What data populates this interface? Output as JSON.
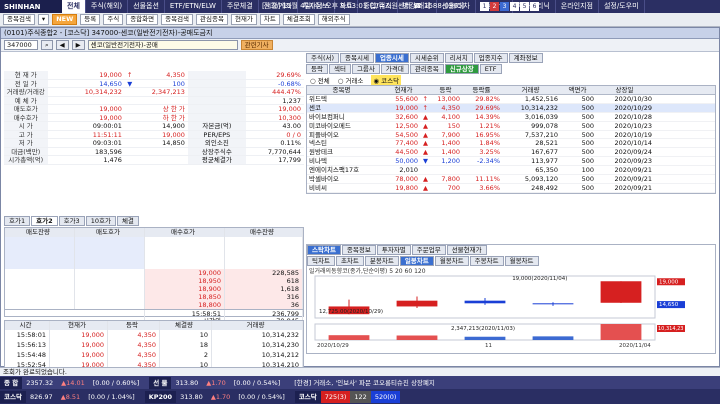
{
  "topbar": {
    "brand": "SHINHAN",
    "menu": [
      "전체",
      "주식(해외)",
      "선물옵션",
      "ETF/ETN/ELW",
      "주문체결",
      "잔고/계좌",
      "투자정보",
      "차트",
      "종합/뉴스",
      "뱅킹/대체",
      "신용/대차",
      "금융상품",
      "투자클리닉",
      "온라인지점",
      "설정/도우미"
    ],
    "active_index": 0,
    "info": "[시장] 11월 4일(수) 오후 8:03:01 (고객지원센터 ☎ 1588-0365)",
    "numbers": [
      "1",
      "2",
      "3",
      "4",
      "5",
      "6"
    ]
  },
  "toolbar": {
    "items": [
      "종목검색",
      "▾",
      "NEW",
      "등록",
      "주식",
      "종합화면",
      "종목검색",
      "관심종목",
      "현재가",
      "차트",
      "체결조회",
      "해외주식"
    ]
  },
  "window": {
    "title": "(0101)주식종합2 - [코스닥] 347000-센코(일반전기전자)-공매도금지"
  },
  "codebar": {
    "code": "347000",
    "name": "센코(일반전기전자)-공매",
    "related": "관련기사",
    "tabs": [
      "증거금",
      "신용",
      "ETF/ETN"
    ]
  },
  "quote": {
    "rows": [
      {
        "label": "현 재 가",
        "v1": "19,000",
        "arrow": "↑",
        "v2": "4,350",
        "v3": "29.69%",
        "cls": "red"
      },
      {
        "label": "전 일 가",
        "v1": "14,650",
        "arrow": "▼",
        "v2": "100",
        "v3": "-0.68%",
        "cls": "blue"
      },
      {
        "label": "거래량/거래강도",
        "v1": "10,314,232",
        "v2": "2,347,213",
        "v3": "444.47%",
        "cls": "red"
      },
      {
        "label": "예 체 가",
        "v1": "",
        "v2": "",
        "v3": "1,237",
        "cls": ""
      },
      {
        "label": "매도호가",
        "v1": "19,000",
        "v2": "상 한 가",
        "v3": "19,000",
        "cls": "red"
      },
      {
        "label": "매수호가",
        "v1": "19,000",
        "v2": "하 한 가",
        "v3": "10,300",
        "cls": "red"
      },
      {
        "label": "시 가",
        "v1": "09:00:01",
        "v2": "14,900",
        "lab2": "자본금(억)",
        "v3": "43.00",
        "cls": ""
      },
      {
        "label": "고 가",
        "v1": "11:51:11",
        "v2": "19,000",
        "lab2": "PER/EPS",
        "v3": "0 / 0",
        "cls": "red"
      },
      {
        "label": "저 가",
        "v1": "09:03:01",
        "v2": "14,850",
        "lab2": "외인소진",
        "v3": "0.11%",
        "cls": ""
      },
      {
        "label": "대금(백만)",
        "v1": "183,596",
        "lab2": "상장주식수",
        "v3": "7,770,644",
        "cls": ""
      },
      {
        "label": "시가총액(억)",
        "v1": "1,476",
        "lab2": "평균체결가",
        "v3": "17,799",
        "cls": ""
      }
    ]
  },
  "hoga": {
    "tabs": [
      "호가1",
      "호가2",
      "호가3",
      "10호가",
      "체결"
    ],
    "active": 1,
    "headers": [
      "매도잔량",
      "매도호가",
      "매수호가",
      "매수잔량"
    ],
    "rows": [
      [
        "",
        "",
        "19,000",
        "228,585"
      ],
      [
        "",
        "",
        "18,950",
        "618"
      ],
      [
        "",
        "",
        "18,900",
        "1,618"
      ],
      [
        "",
        "",
        "18,850",
        "316"
      ],
      [
        "",
        "",
        "18,800",
        "36"
      ]
    ],
    "time": "15:58:51",
    "time_total": "236,799",
    "total_label": "시간외",
    "total_value": "70,845"
  },
  "ticks": {
    "headers": [
      "시간",
      "현재가",
      "등락",
      "체결량",
      "거래량"
    ],
    "rows": [
      [
        "15:58:01",
        "19,000",
        "4,350",
        "10",
        "10,314,232"
      ],
      [
        "15:56:13",
        "19,000",
        "4,350",
        "18",
        "10,314,230"
      ],
      [
        "15:54:48",
        "19,000",
        "4,350",
        "2",
        "10,314,212"
      ],
      [
        "15:52:54",
        "19,000",
        "4,350",
        "10",
        "10,314,210"
      ],
      [
        "15:50:01",
        "19,000",
        "4,350",
        "12",
        "10,314,202"
      ]
    ]
  },
  "right": {
    "toptabs": [
      "주식(서)",
      "종목시세",
      "업종시세",
      "시세순위",
      "리서치",
      "업종지수",
      "계좌정보"
    ],
    "activetop": 2,
    "subtabs": [
      "등락",
      "섹터",
      "그룹사",
      "가격대",
      "관리종목",
      "신규상장",
      "ETF"
    ],
    "activesub": 5,
    "radio": [
      "전체",
      "거래소",
      "코스닥"
    ],
    "radio_sel": 2,
    "headers": [
      "종목명",
      "현재가",
      "등락",
      "등락률",
      "거래량",
      "액면가",
      "상장일"
    ],
    "rows": [
      [
        "위드텍",
        "55,600",
        "↑",
        "13,000",
        "29.82%",
        "1,452,516",
        "500",
        "2020/10/30"
      ],
      [
        "센코",
        "19,000",
        "↑",
        "4,350",
        "29.69%",
        "10,314,232",
        "500",
        "2020/10/29"
      ],
      [
        "바이브컴퍼니",
        "32,600",
        "▲",
        "4,100",
        "14.39%",
        "3,016,039",
        "500",
        "2020/10/28"
      ],
      [
        "미코바이오메드",
        "12,500",
        "▲",
        "150",
        "1.21%",
        "999,078",
        "500",
        "2020/10/23"
      ],
      [
        "피플바이오",
        "54,500",
        "▲",
        "7,900",
        "16.95%",
        "7,537,210",
        "500",
        "2020/10/19"
      ],
      [
        "넥스틴",
        "77,400",
        "▲",
        "1,400",
        "1.84%",
        "28,521",
        "500",
        "2020/10/14"
      ],
      [
        "원방테크",
        "44,500",
        "▲",
        "1,400",
        "3.25%",
        "167,677",
        "500",
        "2020/09/24"
      ],
      [
        "비나텍",
        "50,000",
        "▼",
        "1,200",
        "-2.34%",
        "113,977",
        "500",
        "2020/09/23"
      ],
      [
        "엔에이치스팩17호",
        "2,010",
        "",
        "",
        "",
        "65,350",
        "100",
        "2020/09/21"
      ],
      [
        "박셀바이오",
        "78,000",
        "▲",
        "7,800",
        "11.11%",
        "5,093,120",
        "500",
        "2020/09/21"
      ],
      [
        "비비씨",
        "19,800",
        "▲",
        "700",
        "3.66%",
        "248,492",
        "500",
        "2020/09/21"
      ]
    ],
    "chart_tabs": [
      "스탁차트",
      "종목정보",
      "투자자별",
      "주문업무",
      "선물현재가"
    ],
    "chart_subtabs": [
      "틱차트",
      "초차트",
      "분봉차트",
      "일봉차트",
      "월봉차트",
      "주봉차트",
      "월봉차트"
    ],
    "chart_title": "일거래의동향코(종가,단순이평) 5 20 60 120",
    "annotations": [
      "19,000(2020/11/04)",
      "12,725.00(2020/10/29)",
      "2,347,213(2020/11/03)"
    ],
    "xlabels": [
      "2020/10/29",
      "11",
      "2020/11/04"
    ],
    "price_tags": [
      "19,000",
      "14,650"
    ],
    "volume_tags": [
      "10,314,23",
      "2,347"
    ],
    "page_no": "5"
  },
  "status": {
    "msg": "조회가 완료되었습니다."
  },
  "bottom": {
    "row1": [
      {
        "label": "종 합",
        "val": "2357.32",
        "chg": "▲14.01",
        "pct": "[0.00 / 0.60%]"
      },
      {
        "label": "선 물",
        "val": "313.80",
        "chg": "▲1.70",
        "pct": "[0.00 / 0.54%]"
      },
      {
        "label": "news",
        "val": "[한경] 거래소, '인보사' 파문 코오롱티슈진 상장폐지"
      }
    ],
    "row2": [
      {
        "label": "코스닥",
        "val": "826.97",
        "chg": "▲8.51",
        "pct": "[0.00 / 1.04%]"
      },
      {
        "label": "KP200",
        "val": "313.80",
        "chg": "▲1.70",
        "pct": "[0.00 / 0.54%]"
      },
      {
        "label": "코스닥",
        "up": "725(3)",
        "down": "122",
        "flat": "520(0)"
      }
    ]
  },
  "chart_data": {
    "type": "candlestick",
    "candles": [
      {
        "date": "2020/10/29",
        "open": 12725,
        "close": 14200,
        "high": 15500,
        "low": 12725
      },
      {
        "date": "2020/10/30",
        "open": 14200,
        "close": 15300,
        "high": 16100,
        "low": 13900
      },
      {
        "date": "2020/11/02",
        "open": 15300,
        "close": 14800,
        "high": 15800,
        "low": 14500
      },
      {
        "date": "2020/11/03",
        "open": 14800,
        "close": 14650,
        "high": 15000,
        "low": 14300
      },
      {
        "date": "2020/11/04",
        "open": 14900,
        "close": 19000,
        "high": 19000,
        "low": 14850
      }
    ],
    "volume": [
      3100000,
      2900000,
      2100000,
      2347213,
      10314232
    ],
    "ylim": [
      12000,
      20000
    ]
  }
}
